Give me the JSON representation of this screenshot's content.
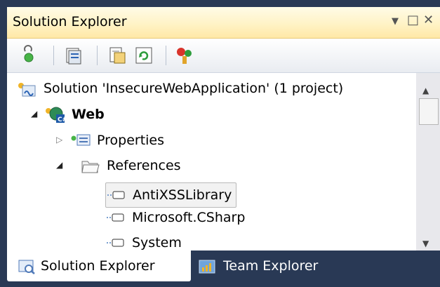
{
  "window": {
    "title": "Solution Explorer",
    "controls": {
      "dropdown": "▼",
      "maximize": "□",
      "close": "✕"
    }
  },
  "toolbar": {
    "buttons": [
      {
        "icon": "properties-icon"
      },
      {
        "icon": "show-all-files-icon"
      },
      {
        "icon": "view-code-icon"
      },
      {
        "icon": "refresh-icon"
      },
      {
        "icon": "class-diagram-icon"
      }
    ]
  },
  "tree": {
    "solution": "Solution 'InsecureWebApplication' (1 project)",
    "project": "Web",
    "properties": "Properties",
    "references": "References",
    "reference_items": [
      "AntiXSSLibrary",
      "Microsoft.CSharp",
      "System"
    ]
  },
  "tabs": {
    "solution_explorer": "Solution Explorer",
    "team_explorer": "Team Explorer"
  },
  "colors": {
    "title_gradient": "#fff3c6",
    "frame": "#293955",
    "selection_border": "#b9b9b9"
  }
}
